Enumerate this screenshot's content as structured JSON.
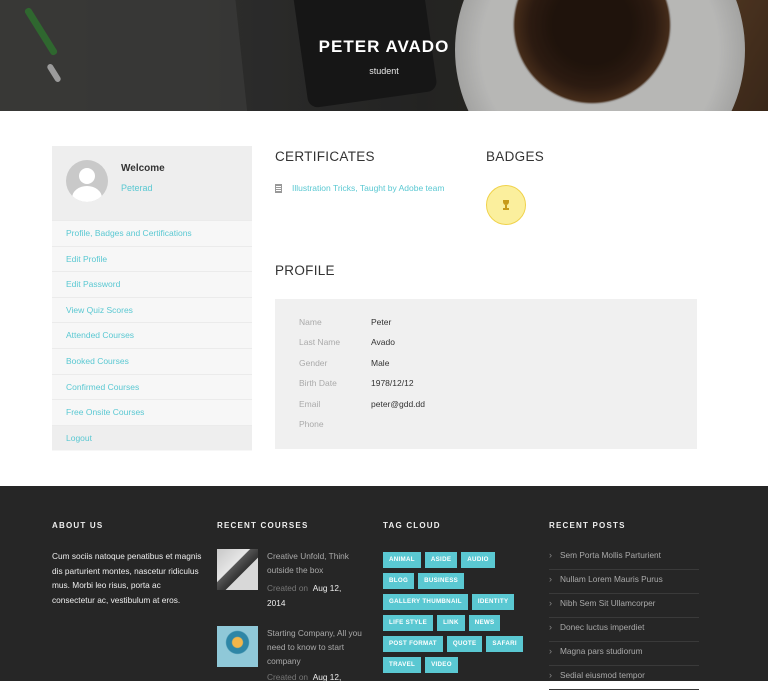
{
  "hero": {
    "name": "PETER AVADO",
    "role": "student"
  },
  "sidebar": {
    "welcome": "Welcome",
    "username": "Peterad",
    "menu": [
      "Profile, Badges and Certifications",
      "Edit Profile",
      "Edit Password",
      "View Quiz Scores",
      "Attended Courses",
      "Booked Courses",
      "Confirmed Courses",
      "Free Onsite Courses",
      "Logout"
    ]
  },
  "certificates": {
    "title": "CERTIFICATES",
    "items": [
      "Illustration Tricks, Taught by Adobe team"
    ]
  },
  "badges": {
    "title": "BADGES"
  },
  "profile": {
    "title": "PROFILE",
    "rows": [
      {
        "key": "Name",
        "value": "Peter"
      },
      {
        "key": "Last Name",
        "value": "Avado"
      },
      {
        "key": "Gender",
        "value": "Male"
      },
      {
        "key": "Birth Date",
        "value": "1978/12/12"
      },
      {
        "key": "Email",
        "value": "peter@gdd.dd"
      },
      {
        "key": "Phone",
        "value": ""
      }
    ]
  },
  "footer": {
    "about": {
      "title": "ABOUT US",
      "text": "Cum sociis natoque penatibus et magnis dis parturient montes, nascetur ridiculus mus. Morbi leo risus, porta ac consectetur ac, vestibulum at eros."
    },
    "recent_courses": {
      "title": "RECENT COURSES",
      "items": [
        {
          "title": "Creative Unfold, Think outside the box",
          "created_label": "Created on",
          "date_a": "Aug 12,",
          "date_b": "2014"
        },
        {
          "title": "Starting Company, All you need to know to start company",
          "created_label": "Created on",
          "date_a": "Aug 12,",
          "date_b": ""
        }
      ]
    },
    "tag_cloud": {
      "title": "TAG CLOUD",
      "tags": [
        "ANIMAL",
        "ASIDE",
        "AUDIO",
        "BLOG",
        "BUSINESS",
        "GALLERY THUMBNAIL",
        "IDENTITY",
        "LIFE STYLE",
        "LINK",
        "NEWS",
        "POST FORMAT",
        "QUOTE",
        "SAFARI",
        "TRAVEL",
        "VIDEO"
      ]
    },
    "recent_posts": {
      "title": "RECENT POSTS",
      "items": [
        "Sem Porta Mollis Parturient",
        "Nullam Lorem Mauris Purus",
        "Nibh Sem Sit Ullamcorper",
        "Donec luctus imperdiet",
        "Magna pars studiorum",
        "Sedial eiusmod tempor"
      ]
    }
  },
  "colors": {
    "accent": "#5ac8d2",
    "footer_bg": "#262626",
    "badge_fill": "#fbef9d"
  }
}
